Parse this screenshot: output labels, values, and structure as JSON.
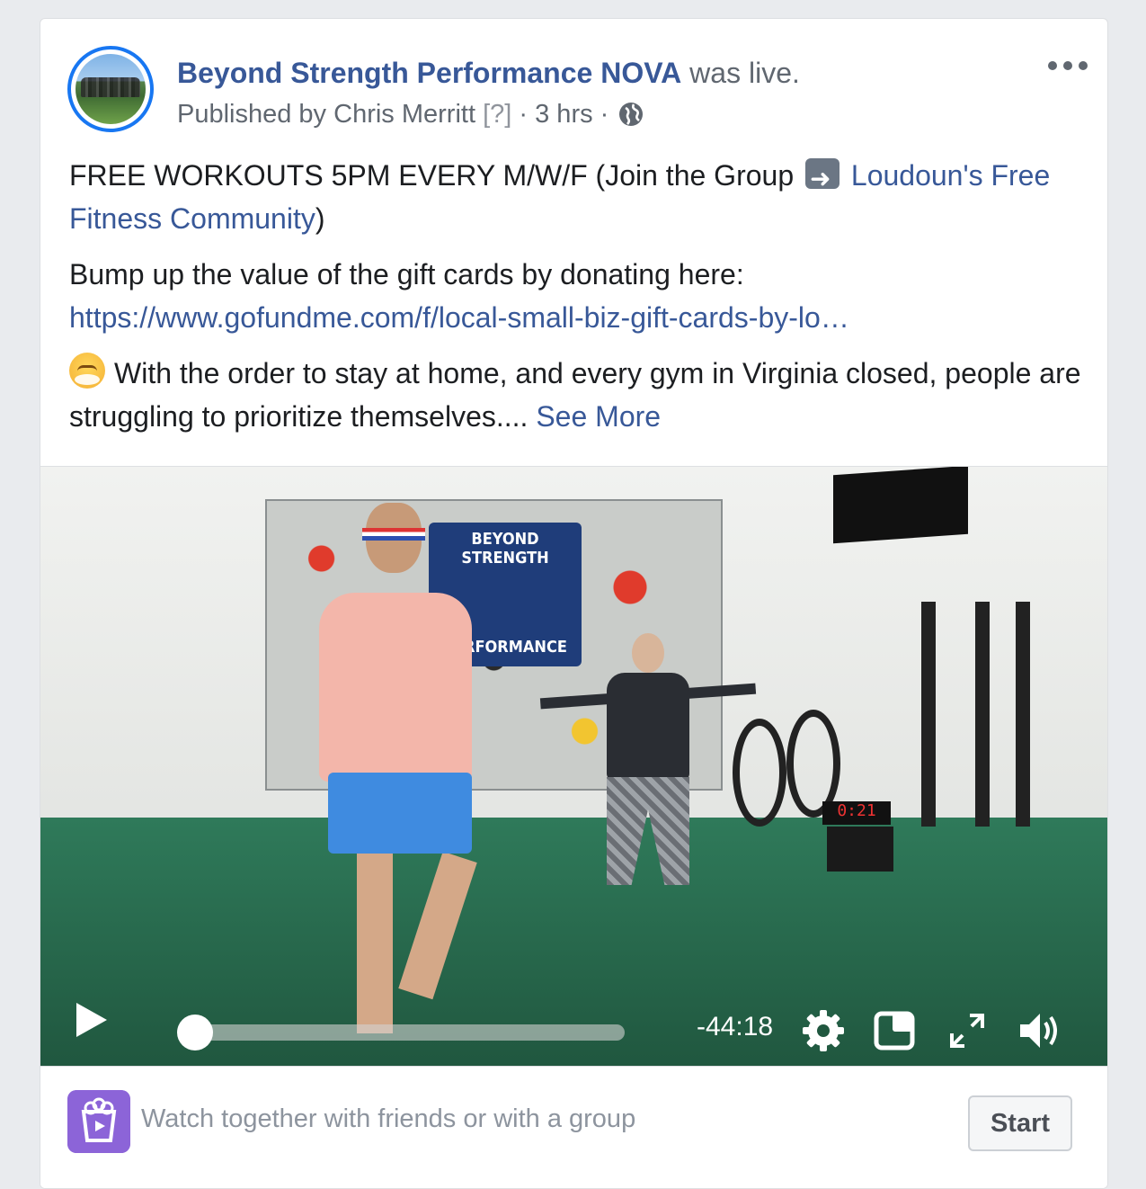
{
  "post": {
    "page_name": "Beyond Strength Performance NOVA",
    "live_status": "was live.",
    "published_prefix": "Published by",
    "publisher": "Chris Merritt",
    "publisher_hint": "[?]",
    "separator": "·",
    "timestamp": "3 hrs",
    "privacy_icon": "globe-icon",
    "more_icon": "more-options-icon"
  },
  "body": {
    "line1_text": "FREE WORKOUTS 5PM EVERY M/W/F (Join the Group",
    "line1_emoji": "right-arrow-emoji",
    "group_link": "Loudoun's Free Fitness Community",
    "line1_close": ")",
    "donate_text": "Bump up the value of the gift cards by donating here:",
    "donate_link": "https://www.gofundme.com/f/local-small-biz-gift-cards-by-lo…",
    "para3_emoji": "steam-face-emoji",
    "para3_text": "With the order to stay at home, and every gym in Virginia closed, people are struggling to prioritize themselves....",
    "see_more": "See More"
  },
  "video": {
    "mural_text_top": "BEYOND STRENGTH",
    "mural_text_bottom": "PERFORMANCE",
    "timer_text": "0:21",
    "time_remaining": "-44:18",
    "progress": 0.03,
    "controls": [
      "play-icon",
      "gear-icon",
      "picture-in-picture-icon",
      "fullscreen-icon",
      "volume-icon"
    ]
  },
  "watch_party": {
    "icon": "watch-party-icon",
    "text": "Watch together with friends or with a group",
    "button": "Start"
  },
  "colors": {
    "link": "#385898",
    "background": "#e9ebee",
    "watch_icon_bg": "#8c64d8",
    "avatar_ring": "#1877f2"
  }
}
